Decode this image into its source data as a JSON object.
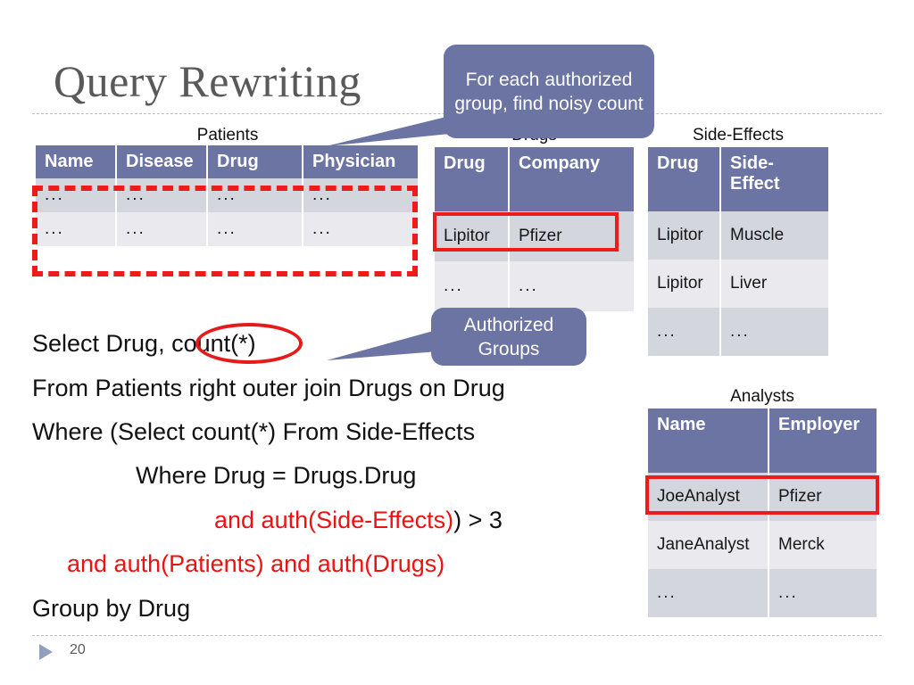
{
  "slide": {
    "title": "Query Rewriting",
    "page_number": "20",
    "accent_color": "#6b74a3",
    "highlight_color": "#ee1b1b",
    "row_dark_color": "#d3d6dc",
    "row_light_color": "#eaeaee",
    "title_color": "#595959"
  },
  "callouts": [
    {
      "id": "noisy-count",
      "text": "For each authorized group, find noisy count"
    },
    {
      "id": "authorized-groups",
      "text": "Authorized Groups"
    }
  ],
  "tables": {
    "patients": {
      "caption": "Patients",
      "headers": [
        "Name",
        "Disease",
        "Drug",
        "Physician"
      ],
      "rows": [
        [
          "...",
          "...",
          "...",
          "..."
        ],
        [
          "...",
          "...",
          "...",
          "..."
        ]
      ]
    },
    "drugs": {
      "caption": "Drugs",
      "headers": [
        "Drug",
        "Company"
      ],
      "rows": [
        [
          "Lipitor",
          "Pfizer"
        ],
        [
          "...",
          "..."
        ]
      ]
    },
    "side_effects": {
      "caption": "Side-Effects",
      "headers": [
        "Drug",
        "Side-Effect"
      ],
      "rows": [
        [
          "Lipitor",
          "Muscle"
        ],
        [
          "Lipitor",
          "Liver"
        ],
        [
          "...",
          "..."
        ]
      ]
    },
    "analysts": {
      "caption": "Analysts",
      "headers": [
        "Name",
        "Employer"
      ],
      "rows": [
        [
          "JoeAnalyst",
          "Pfizer"
        ],
        [
          "JaneAnalyst",
          "Merck"
        ],
        [
          "...",
          "..."
        ]
      ]
    }
  },
  "query": {
    "line1_a": "Select  Drug, ",
    "line1_b": "count(*)",
    "line2": "From Patients right outer join Drugs on Drug",
    "line3": "Where (Select count(*) From Side-Effects",
    "line4": "Where Drug = Drugs.Drug",
    "line5_red": "and auth(Side-Effects)",
    "line5_black": ") > 3",
    "line6_red": "and auth(Patients) and auth(Drugs)",
    "line7": "Group by Drug"
  }
}
